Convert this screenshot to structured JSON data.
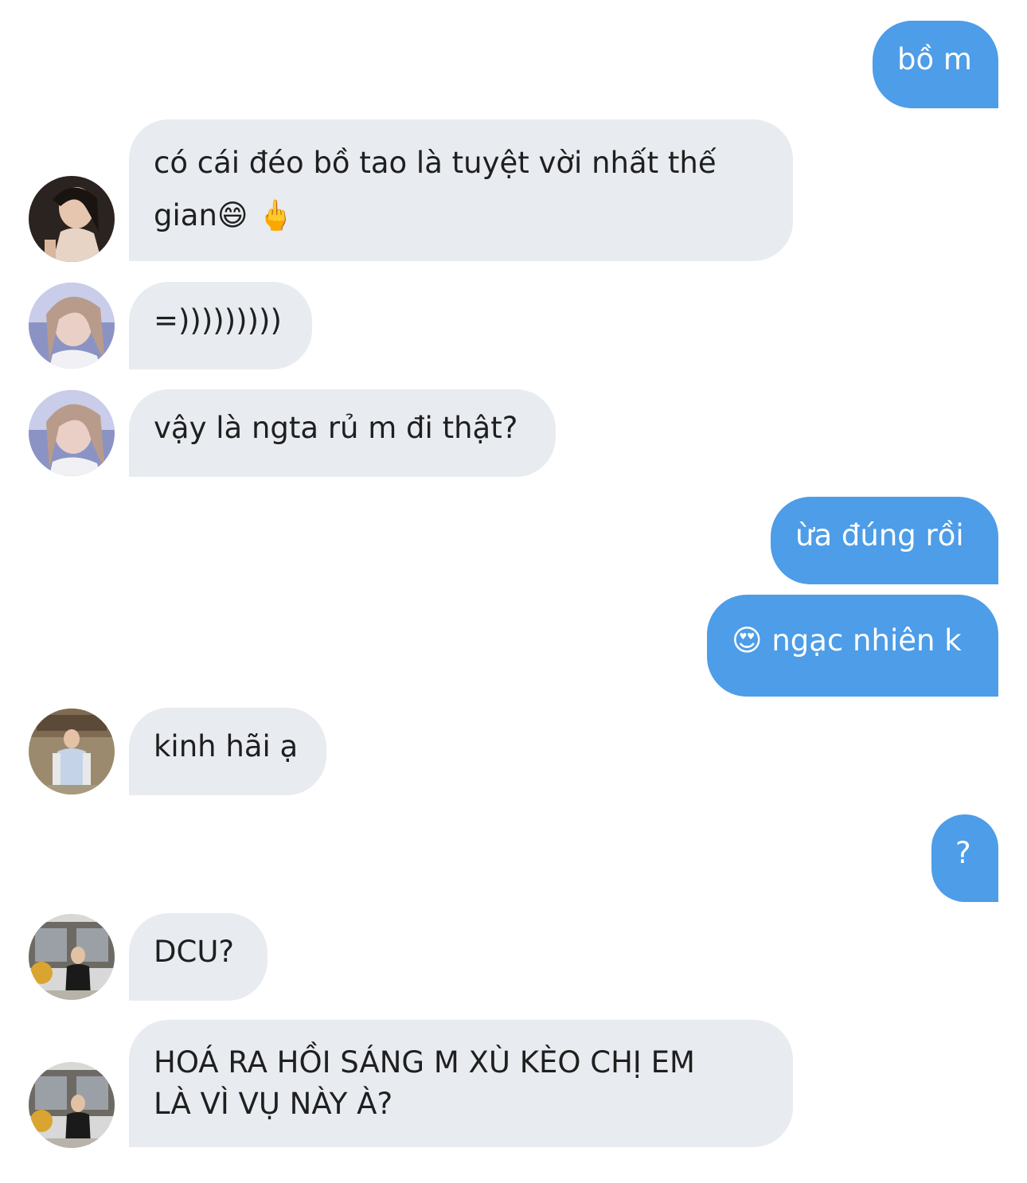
{
  "messages": [
    {
      "text": "bồ m"
    },
    {
      "text": "có cái đéo bồ tao là tuyệt vời nhất thế",
      "text2": "gian😄 🖕"
    },
    {
      "text": "=)))))))))"
    },
    {
      "text": "vậy là ngta rủ m đi thật?"
    },
    {
      "text": "ừa đúng rồi"
    },
    {
      "text": "😍 ngạc nhiên k"
    },
    {
      "text": "kinh hãi ạ"
    },
    {
      "text": "?"
    },
    {
      "text": "DCU?"
    },
    {
      "text": "HOÁ RA HỒI SÁNG M XÙ KÈO CHỊ EM",
      "text2": "LÀ VÌ VỤ NÀY À?"
    }
  ],
  "colors": {
    "outgoing_bubble": "#4d9de8",
    "incoming_bubble": "#e8ebf0",
    "background": "#ffffff"
  }
}
